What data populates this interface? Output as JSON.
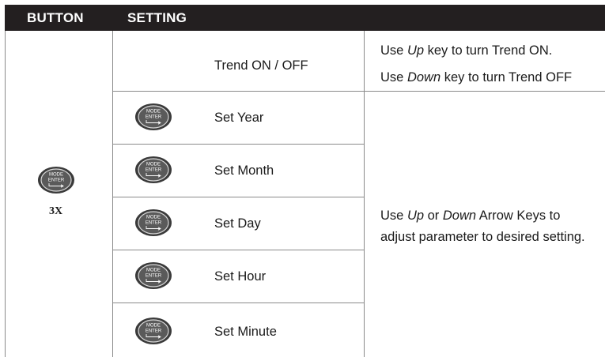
{
  "header": {
    "col_button": "BUTTON",
    "col_setting": "SETTING"
  },
  "button_cell": {
    "icon_line1": "MODE",
    "icon_line2": "ENTER",
    "press_count": "3X"
  },
  "rows": [
    {
      "setting": "Trend ON / OFF"
    },
    {
      "setting": "Set Year",
      "icon_line1": "MODE",
      "icon_line2": "ENTER"
    },
    {
      "setting": "Set Month",
      "icon_line1": "MODE",
      "icon_line2": "ENTER"
    },
    {
      "setting": "Set Day",
      "icon_line1": "MODE",
      "icon_line2": "ENTER"
    },
    {
      "setting": "Set Hour",
      "icon_line1": "MODE",
      "icon_line2": "ENTER"
    },
    {
      "setting": "Set Minute",
      "icon_line1": "MODE",
      "icon_line2": "ENTER"
    }
  ],
  "descriptions": {
    "trend": {
      "line1": {
        "pre": "Use ",
        "key": "Up",
        "post": " key to turn Trend ON."
      },
      "line2": {
        "pre": "Use ",
        "key": "Down",
        "post": " key to turn Trend OFF"
      }
    },
    "adjust": {
      "line1": {
        "pre": "Use ",
        "key1": "Up",
        "mid": " or ",
        "key2": "Down",
        "post": " Arrow Keys to"
      },
      "line2": "adjust parameter to desired setting."
    }
  }
}
